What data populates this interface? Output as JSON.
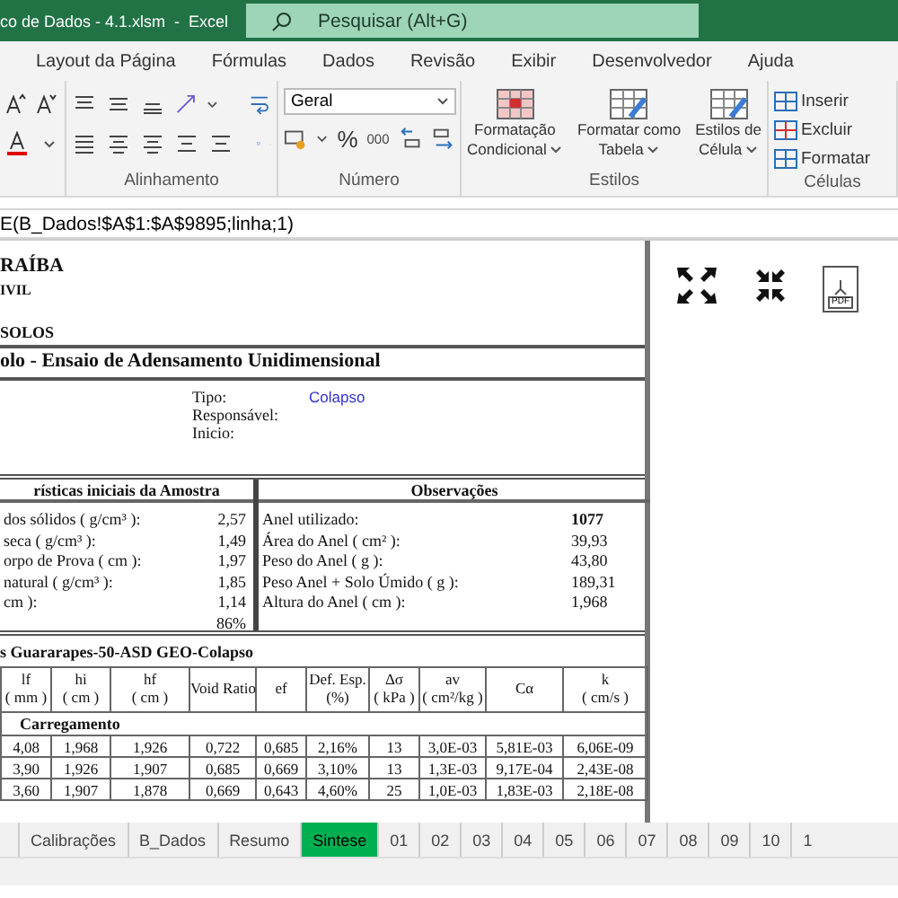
{
  "window": {
    "title": "co de Dados - 4.1.xlsm  -  Excel"
  },
  "search": {
    "placeholder": "Pesquisar (Alt+G)"
  },
  "ribbon_tabs": [
    "Layout da Página",
    "Fórmulas",
    "Dados",
    "Revisão",
    "Exibir",
    "Desenvolvedor",
    "Ajuda"
  ],
  "ribbon": {
    "alignment_label": "Alinhamento",
    "number_label": "Número",
    "number_format": "Geral",
    "percent": "%",
    "thousands": "000",
    "styles_label": "Estilos",
    "cells_label": "Células",
    "style_buttons": [
      {
        "line1": "Formatação",
        "line2": "Condicional"
      },
      {
        "line1": "Formatar como",
        "line2": "Tabela"
      },
      {
        "line1": "Estilos de",
        "line2": "Célula"
      }
    ],
    "cell_buttons": [
      "Inserir",
      "Excluir",
      "Formatar"
    ]
  },
  "formula": "E(B_Dados!$A$1:$A$9895;linha;1)",
  "report": {
    "institution": "RAÍBA",
    "department": "IVIL",
    "lab": "SOLOS",
    "title": "olo - Ensaio de Adensamento Unidimensional",
    "info": [
      {
        "label": "Tipo:",
        "value": "Colapso"
      },
      {
        "label": "Responsável:"
      },
      {
        "label": "Inicio:"
      }
    ],
    "sample": {
      "title": "rísticas iniciais da Amostra",
      "rows": [
        {
          "label": "dos sólidos ( g/cm³ ):",
          "value": "2,57"
        },
        {
          "label": "seca ( g/cm³ ):",
          "value": "1,49"
        },
        {
          "label": "orpo de Prova ( cm ):",
          "value": "1,97"
        },
        {
          "label": "natural ( g/cm³ ):",
          "value": "1,85"
        },
        {
          "label": "cm ):",
          "value": "1,14"
        },
        {
          "value": "86%"
        }
      ]
    },
    "observations": {
      "title": "Observações",
      "rows": [
        {
          "label": "Anel utilizado:",
          "value": "1077",
          "bold": true
        },
        {
          "label": "Área do Anel ( cm² ):",
          "value": "39,93",
          "bold": false
        },
        {
          "label": "Peso do Anel ( g ):",
          "value": "43,80",
          "bold": false
        },
        {
          "label": "Peso Anel + Solo Úmido ( g ):",
          "value": "189,31",
          "bold": false
        },
        {
          "label": "Altura do Anel ( cm ):",
          "value": "1,968",
          "bold": false
        }
      ]
    },
    "table": {
      "title": "s Guararapes-50-ASD GEO-Colapso",
      "columns": [
        {
          "line1": "lf",
          "line2": "( mm )"
        },
        {
          "line1": "hi",
          "line2": "( cm )"
        },
        {
          "line1": "hf",
          "line2": "( cm )"
        },
        {
          "line1": "Void Ratio"
        },
        {
          "line1": "ef"
        },
        {
          "line1": "Def. Esp.",
          "line2": "(%)"
        },
        {
          "line1": "Δσ",
          "line2": "( kPa )"
        },
        {
          "line1": "av",
          "line2": "( cm²/kg )"
        },
        {
          "line1": "Cα"
        },
        {
          "line1": "k",
          "line2": "( cm/s )"
        }
      ],
      "section": "Carregamento",
      "rows": [
        [
          "4,08",
          "1,968",
          "1,926",
          "0,722",
          "0,685",
          "2,16%",
          "13",
          "3,0E-03",
          "5,81E-03",
          "6,06E-09"
        ],
        [
          "3,90",
          "1,926",
          "1,907",
          "0,685",
          "0,669",
          "3,10%",
          "13",
          "1,3E-03",
          "9,17E-04",
          "2,43E-08"
        ],
        [
          "3,60",
          "1,907",
          "1,878",
          "0,669",
          "0,643",
          "4,60%",
          "25",
          "1,0E-03",
          "1,83E-03",
          "2,18E-08"
        ]
      ]
    },
    "pdf_label": "PDF"
  },
  "sheet_tabs": [
    {
      "label": "Calibrações",
      "selected": false
    },
    {
      "label": "B_Dados",
      "selected": false
    },
    {
      "label": "Resumo",
      "selected": false
    },
    {
      "label": "Sintese",
      "selected": true
    },
    {
      "label": "01",
      "selected": false
    },
    {
      "label": "02",
      "selected": false
    },
    {
      "label": "03",
      "selected": false
    },
    {
      "label": "04",
      "selected": false
    },
    {
      "label": "05",
      "selected": false
    },
    {
      "label": "06",
      "selected": false
    },
    {
      "label": "07",
      "selected": false
    },
    {
      "label": "08",
      "selected": false
    },
    {
      "label": "09",
      "selected": false
    },
    {
      "label": "10",
      "selected": false
    },
    {
      "label": "1",
      "selected": false
    }
  ]
}
